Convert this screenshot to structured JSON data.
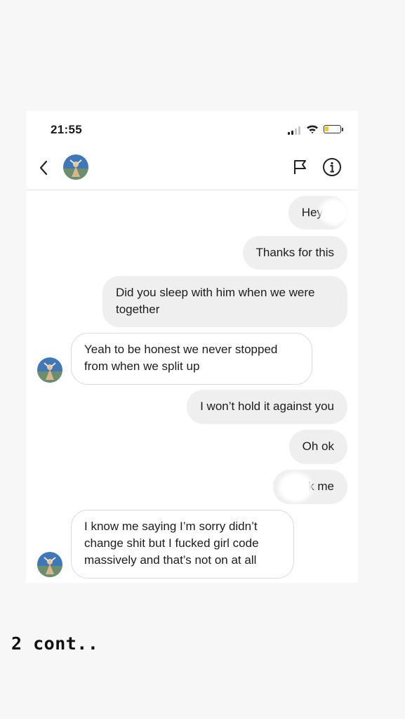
{
  "status_bar": {
    "time": "21:55",
    "icons": [
      "signal-icon",
      "wifi-icon",
      "battery-icon"
    ]
  },
  "header": {
    "icons": [
      "back-chevron-icon",
      "avatar",
      "flag-icon",
      "info-icon"
    ]
  },
  "messages": [
    {
      "direction": "sent",
      "text": "Hey E"
    },
    {
      "direction": "sent",
      "text": "Thanks for this"
    },
    {
      "direction": "sent",
      "text": "Did you sleep with him when we were\ntogether"
    },
    {
      "direction": "received",
      "text": "Yeah to be honest we never stopped\nfrom when we split up"
    },
    {
      "direction": "sent",
      "text": "I won’t hold it against you"
    },
    {
      "direction": "sent",
      "text": "Oh ok"
    },
    {
      "direction": "sent",
      "text": "k me"
    },
    {
      "direction": "received",
      "text": "I know me saying I’m sorry didn’t\nchange shit but I fucked girl code\nmassively and that’s not on at all"
    }
  ],
  "caption": "2 cont..",
  "colors": {
    "background": "#f8f7f7",
    "sent_bubble": "#efefef",
    "received_border": "#dbdbdb",
    "battery": "#f3c62e"
  }
}
